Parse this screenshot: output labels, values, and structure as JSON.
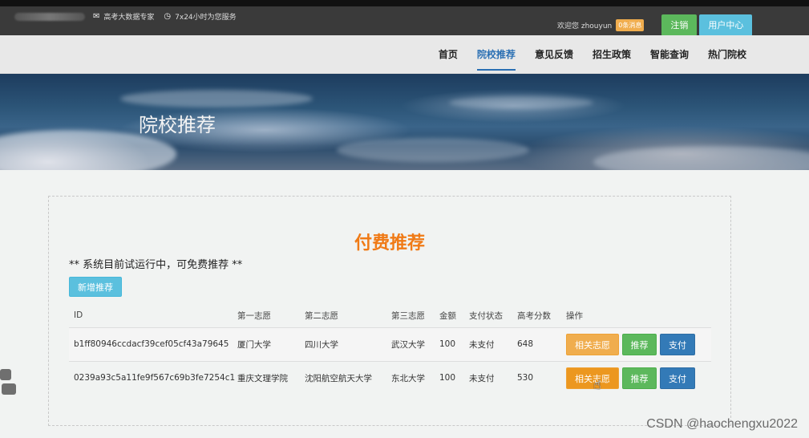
{
  "topbar": {
    "slogan": "高考大数据专家",
    "service": "7x24小时为您服务",
    "welcome": "欢迎您 zhouyun",
    "badge": "0条消息",
    "logout_label": "注销",
    "user_center_label": "用户中心"
  },
  "nav": {
    "items": [
      {
        "label": "首页"
      },
      {
        "label": "院校推荐"
      },
      {
        "label": "意见反馈"
      },
      {
        "label": "招生政策"
      },
      {
        "label": "智能查询"
      },
      {
        "label": "热门院校"
      }
    ],
    "active": "院校推荐"
  },
  "banner": {
    "title": "院校推荐"
  },
  "main": {
    "title": "付费推荐",
    "notice": "** 系统目前试运行中，可免费推荐 **",
    "add_button": "新增推荐",
    "table": {
      "headers": [
        "ID",
        "第一志愿",
        "第二志愿",
        "第三志愿",
        "金额",
        "支付状态",
        "高考分数",
        "操作"
      ],
      "rows": [
        [
          "b1ff80946ccdacf39cef05cf43a79645",
          "厦门大学",
          "四川大学",
          "武汉大学",
          "100",
          "未支付",
          "648"
        ],
        [
          "0239a93c5a11fe9f567c69b3fe7254c1",
          "重庆文理学院",
          "沈阳航空航天大学",
          "东北大学",
          "100",
          "未支付",
          "530"
        ]
      ],
      "actions": {
        "related": "相关志愿",
        "recommend": "推荐",
        "pay": "支付"
      }
    }
  },
  "watermark": "CSDN @haochengxu2022",
  "colors": {
    "accent_orange": "#f07a16",
    "nav_active": "#2a6fb3",
    "btn_info": "#5bc0de",
    "btn_success": "#5cb85c",
    "btn_warning": "#f0ad4e",
    "btn_primary": "#337ab7"
  },
  "icons": {
    "slogan": "envelope-icon",
    "service": "clock-icon"
  }
}
